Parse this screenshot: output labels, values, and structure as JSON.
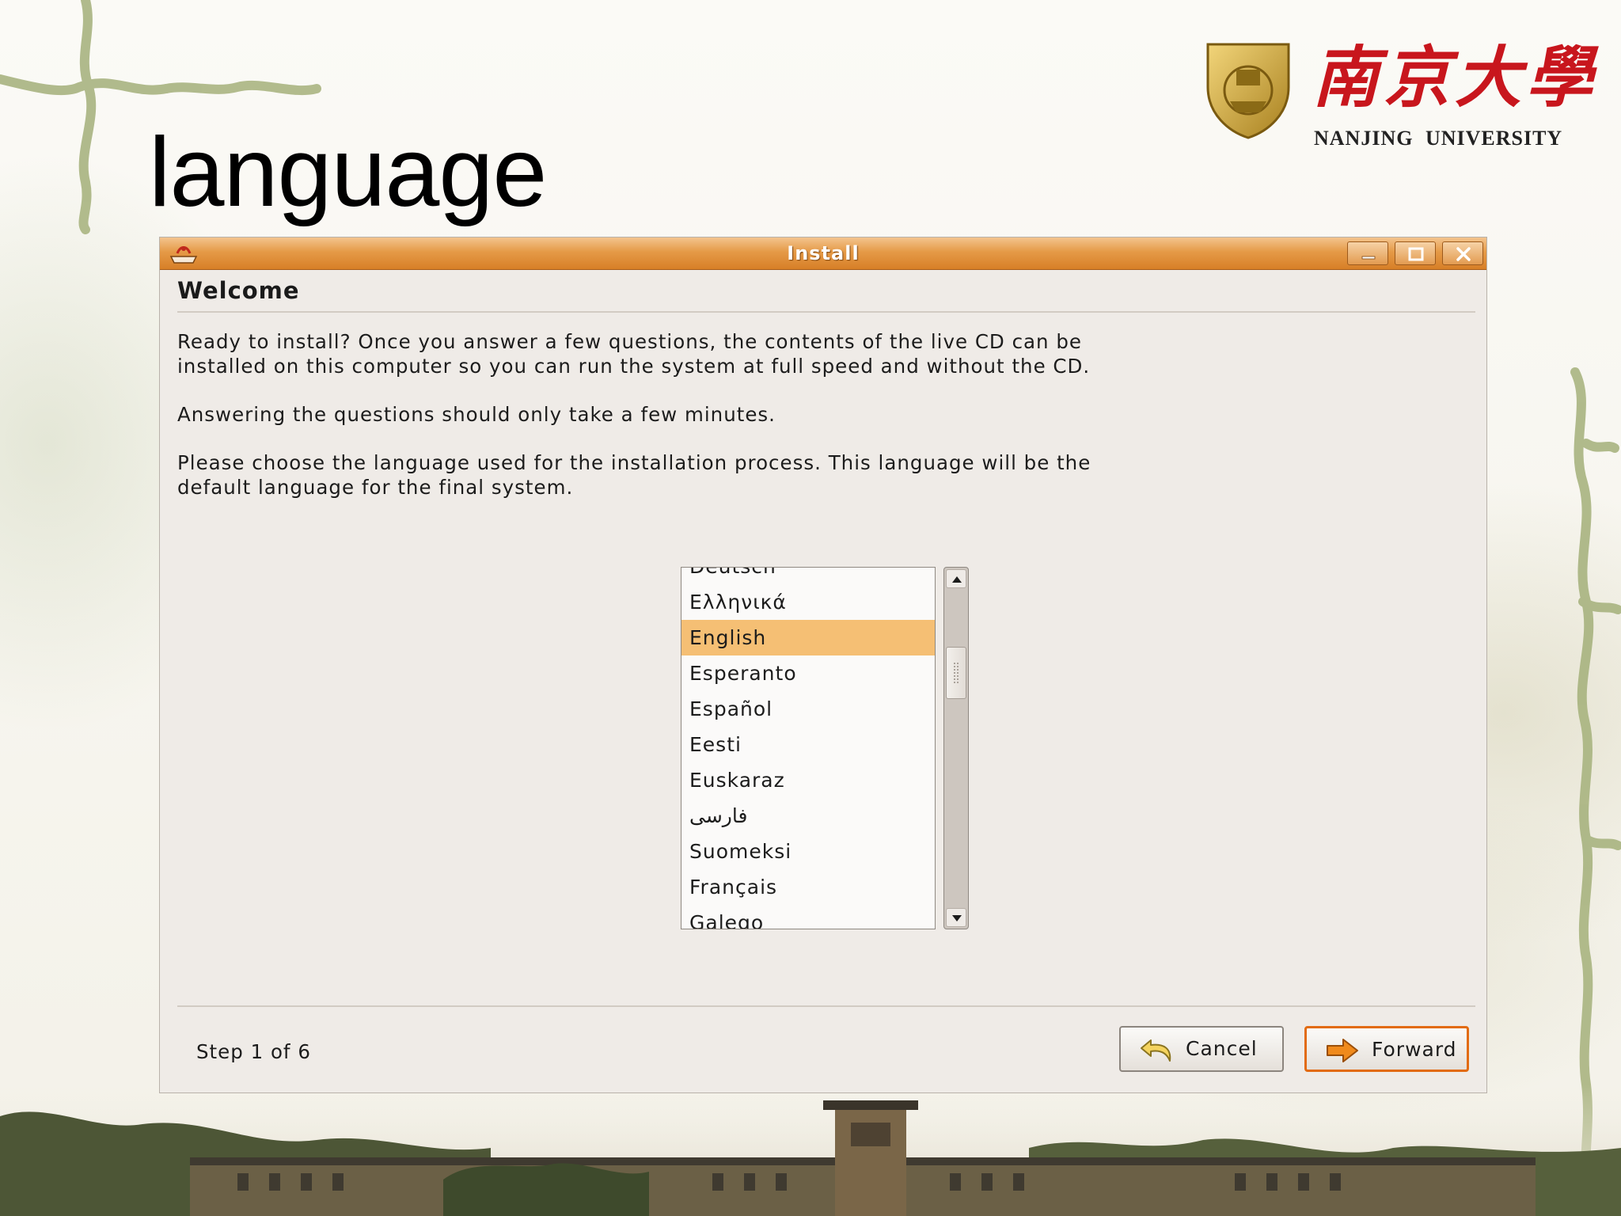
{
  "slide": {
    "title": "language",
    "logo": {
      "chinese_name": "南京大學",
      "english_name": "NANJING UNIVERSITY"
    }
  },
  "window": {
    "title": "Install",
    "heading": "Welcome",
    "paragraphs": [
      "Ready to install? Once you answer a few questions, the contents of the live CD can be\ninstalled on this computer so you can run the system at full speed and without the CD.",
      "Answering the questions should only take a few minutes.",
      "Please choose the language used for the installation process. This language will be the\ndefault language for the final system."
    ],
    "language_list": {
      "items": [
        "Deutsch",
        "Ελληνικά",
        "English",
        "Esperanto",
        "Español",
        "Eesti",
        "Euskaraz",
        "فارسی",
        "Suomeksi",
        "Français",
        "Galego"
      ],
      "selected": "English"
    },
    "footer": {
      "step": "Step 1 of 6",
      "cancel_label": "Cancel",
      "forward_label": "Forward"
    },
    "colors": {
      "titlebar": "#e59a47",
      "selection": "#f5bf74",
      "forward_border": "#e26b12"
    },
    "icons": {
      "app": "install-icon",
      "cancel": "undo-arrow-icon",
      "forward": "right-arrow-icon"
    }
  }
}
